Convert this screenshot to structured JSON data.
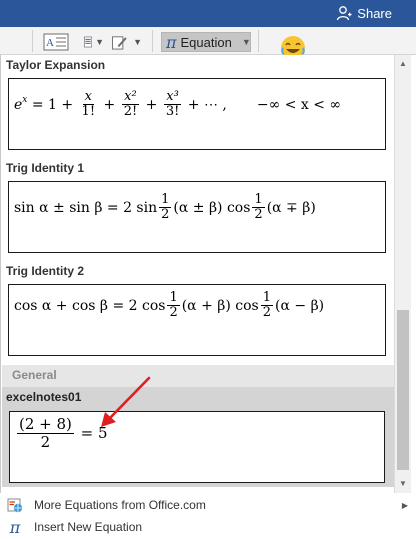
{
  "titlebar": {
    "share_label": "Share"
  },
  "ribbon": {
    "equation_label": "Equation"
  },
  "gallery": {
    "sections": [
      {
        "title": "Taylor Expansion"
      },
      {
        "title": "Trig Identity 1"
      },
      {
        "title": "Trig Identity 2"
      }
    ],
    "general_label": "General",
    "user_title": "excelnotes01",
    "equations": {
      "taylor": {
        "e": "e",
        "x_sup": "x",
        "eq": " = 1 + ",
        "f1n": "x",
        "f1d": "1!",
        "plus": " + ",
        "f2n": "x²",
        "f2d": "2!",
        "f3n": "x³",
        "f3d": "3!",
        "tail": " + ⋯ ,",
        "range": "−∞ < x < ∞"
      },
      "trig1": {
        "lhs": "sin α ± sin β = 2 sin",
        "half_n": "1",
        "half_d": "2",
        "a1": "(α ± β) cos",
        "a2": "(α ∓ β)"
      },
      "trig2": {
        "lhs": "cos α + cos β = 2 cos",
        "half_n": "1",
        "half_d": "2",
        "a1": "(α + β) cos",
        "a2": "(α − β)"
      },
      "user": {
        "num": "(2 + 8)",
        "den": "2",
        "rhs": " = 5"
      }
    }
  },
  "menu": {
    "items": [
      {
        "label": "More Equations from Office.com"
      },
      {
        "label": "Insert New Equation"
      }
    ]
  },
  "colors": {
    "title_bar": "#2b579a",
    "arrow": "#e02020",
    "band_general": "#e6e6e6",
    "band_user": "#d4d4d4"
  }
}
